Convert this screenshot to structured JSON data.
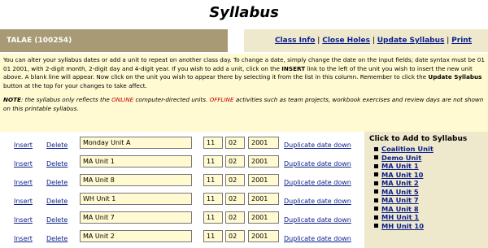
{
  "page_title": "Syllabus",
  "class_code": "TALAE (100254)",
  "links": [
    "Class Info",
    "Close Holes",
    "Update Syllabus",
    "Print Syllabus"
  ],
  "info": {
    "p1": "You can alter your syllabus dates or add a unit to repeat on another class day. To change a date, simply change the date on the input fields; date syntax must be 01 01 2001, with 2-digit month, 2-digit day and 4-digit year. If you wish to add a unit, click on the",
    "insert_word": "INSERT",
    "p2": "link to the left of the unit you wish to insert the new unit above. A blank line will appear. Now click on the unit you wish to appear there by selecting it from the list in this column. Remember to click the",
    "update_button_text": "Update Syllabus",
    "p3": "button at the top for your changes to take affect.",
    "note_label": "NOTE",
    "note1": ": the syllabus only reflects the",
    "online": "ONLINE",
    "note2": "computer-directed units.",
    "offline": "OFFLINE",
    "note3": "activities such as team projects, workbook exercises and review days are not shown on this printable syllabus."
  },
  "row_labels": {
    "insert": "Insert",
    "delete": "Delete",
    "duplicate": "Duplicate date down"
  },
  "syllabus_rows": [
    {
      "unit": "Monday Unit A",
      "month": "11",
      "day": "02",
      "year": "2001"
    },
    {
      "unit": "MA Unit 1",
      "month": "11",
      "day": "02",
      "year": "2001"
    },
    {
      "unit": "MA Unit 8",
      "month": "11",
      "day": "02",
      "year": "2001"
    },
    {
      "unit": "WH Unit 1",
      "month": "11",
      "day": "02",
      "year": "2001"
    },
    {
      "unit": "MA Unit 7",
      "month": "11",
      "day": "02",
      "year": "2001"
    },
    {
      "unit": "MA Unit 2",
      "month": "11",
      "day": "02",
      "year": "2001"
    }
  ],
  "add_panel": {
    "heading": "Click to Add to Syllabus",
    "items": [
      "Coalition Unit",
      "Demo Unit",
      "MA Unit 1",
      "MA Unit 10",
      "MA Unit 2",
      "MA Unit 5",
      "MA Unit 7",
      "MA Unit 8",
      "MH Unit 1",
      "MH Unit 10"
    ]
  }
}
